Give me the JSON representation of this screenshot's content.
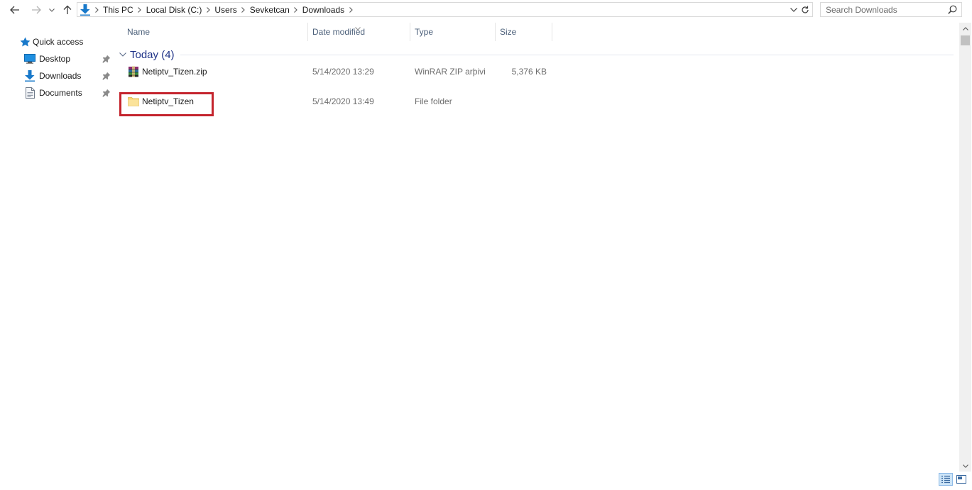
{
  "colors": {
    "accent": "#1979ca",
    "group_header_text": "#1e3287",
    "column_header_text": "#4c607a",
    "highlight_border": "#c4242d",
    "folder_yellow": "#f8d775"
  },
  "breadcrumb": {
    "items": [
      "This PC",
      "Local Disk (C:)",
      "Users",
      "Sevketcan",
      "Downloads"
    ]
  },
  "search": {
    "placeholder": "Search Downloads",
    "value": ""
  },
  "sidebar": {
    "items": [
      {
        "label": "Quick access",
        "icon": "star-icon",
        "pinned": false
      },
      {
        "label": "Desktop",
        "icon": "desktop-icon",
        "pinned": true
      },
      {
        "label": "Downloads",
        "icon": "download-arrow-icon",
        "pinned": true
      },
      {
        "label": "Documents",
        "icon": "documents-icon",
        "pinned": true
      }
    ]
  },
  "columns": [
    "Name",
    "Date modified",
    "Type",
    "Size"
  ],
  "group": {
    "label": "Today (4)"
  },
  "files": [
    {
      "name": "Netiptv_Tizen.zip",
      "date": "5/14/2020 13:29",
      "type": "WinRAR ZIP arþivi",
      "size": "5,376 KB",
      "icon": "winrar-archive-icon"
    },
    {
      "name": "Netiptv_Tizen",
      "date": "5/14/2020 13:49",
      "type": "File folder",
      "size": "",
      "icon": "folder-icon"
    }
  ],
  "view": {
    "active": "details"
  }
}
